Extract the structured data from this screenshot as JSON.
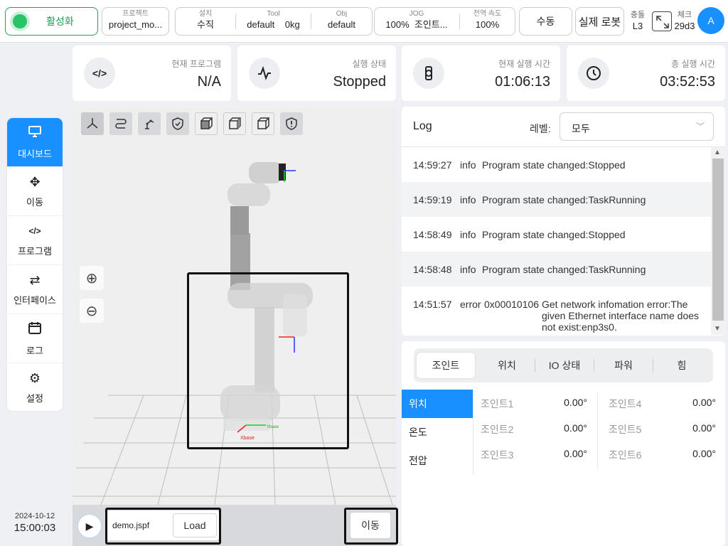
{
  "topbar": {
    "activate_label": "활성화",
    "project": {
      "title": "프로젝트",
      "value": "project_mo..."
    },
    "install": {
      "title": "설치",
      "value": "수직"
    },
    "tool": {
      "title": "Tool",
      "name": "default",
      "weight": "0kg"
    },
    "obj": {
      "title": "Obj",
      "value": "default"
    },
    "jog": {
      "title": "JOG",
      "speed": "100%",
      "mode": "조인트..."
    },
    "global_speed": {
      "title": "전역 속도",
      "value": "100%"
    },
    "manual_label": "수동",
    "real_robot_label": "실제 로봇",
    "collision": {
      "title": "충돌",
      "value": "L3"
    },
    "check": {
      "title": "체크",
      "value": "29d3"
    },
    "avatar_letter": "A",
    "accent_color": "#1890ff",
    "active_color": "#2bc36a"
  },
  "cards": [
    {
      "label": "현재 프로그램",
      "value": "N/A",
      "icon": "code-icon"
    },
    {
      "label": "실행 상태",
      "value": "Stopped",
      "icon": "pulse-icon"
    },
    {
      "label": "현재 실행 시간",
      "value": "01:06:13",
      "icon": "watch-icon"
    },
    {
      "label": "총 실행 시간",
      "value": "03:52:53",
      "icon": "clock-icon"
    }
  ],
  "sidenav": {
    "items": [
      {
        "label": "대시보드",
        "icon": "monitor-icon"
      },
      {
        "label": "이동",
        "icon": "move-icon"
      },
      {
        "label": "프로그램",
        "icon": "code-icon"
      },
      {
        "label": "인터페이스",
        "icon": "swap-icon"
      },
      {
        "label": "로그",
        "icon": "calendar-icon"
      },
      {
        "label": "설정",
        "icon": "gear-icon"
      }
    ],
    "date": "2024-10-12",
    "time": "15:00:03"
  },
  "viewport": {
    "file_name": "demo.jspf",
    "load_label": "Load",
    "move_label": "이동",
    "base_x_label": "Xbase",
    "base_y_label": "Ybase"
  },
  "log": {
    "title": "Log",
    "level_label": "레벨:",
    "level_value": "모두",
    "rows": [
      {
        "time": "14:59:27",
        "level": "info",
        "code": "",
        "message": "Program state changed:Stopped"
      },
      {
        "time": "14:59:19",
        "level": "info",
        "code": "",
        "message": "Program state changed:TaskRunning"
      },
      {
        "time": "14:58:49",
        "level": "info",
        "code": "",
        "message": "Program state changed:Stopped"
      },
      {
        "time": "14:58:48",
        "level": "info",
        "code": "",
        "message": "Program state changed:TaskRunning"
      },
      {
        "time": "14:51:57",
        "level": "error",
        "code": "0x00010106",
        "message": "Get network infomation error:The given Ethernet interface name does not exist:enp3s0."
      }
    ]
  },
  "joints": {
    "tabs": [
      "조인트",
      "위치",
      "IO 상태",
      "파워",
      "힘"
    ],
    "subtabs": [
      "위치",
      "온도",
      "전압"
    ],
    "values": [
      {
        "name": "조인트1",
        "value": "0.00°"
      },
      {
        "name": "조인트2",
        "value": "0.00°"
      },
      {
        "name": "조인트3",
        "value": "0.00°"
      },
      {
        "name": "조인트4",
        "value": "0.00°"
      },
      {
        "name": "조인트5",
        "value": "0.00°"
      },
      {
        "name": "조인트6",
        "value": "0.00°"
      }
    ]
  }
}
